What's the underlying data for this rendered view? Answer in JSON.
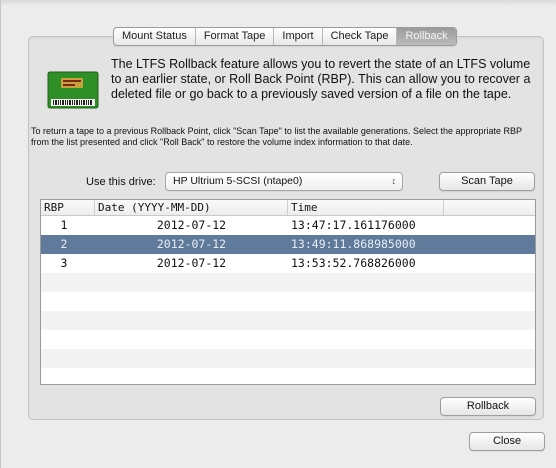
{
  "tabs": [
    {
      "label": "Mount Status"
    },
    {
      "label": "Format Tape"
    },
    {
      "label": "Import"
    },
    {
      "label": "Check Tape"
    },
    {
      "label": "Rollback",
      "active": true
    }
  ],
  "intro_text": "The LTFS Rollback feature allows you to revert the state of an LTFS volume to an earlier state, or Roll Back Point (RBP). This can allow you to recover a deleted file or go back to a previously saved version of a file on the tape.",
  "instructions_text": "To return a tape to a previous Rollback Point, click \"Scan Tape\" to list the available generations. Select the appropriate RBP from the list presented and click \"Roll Back\" to restore the volume index information to that date.",
  "drive": {
    "label": "Use this drive:",
    "selected": "HP Ultrium 5-SCSI (ntape0)"
  },
  "buttons": {
    "scan_tape": "Scan Tape",
    "rollback": "Rollback",
    "close": "Close"
  },
  "table": {
    "columns": [
      "RBP",
      "Date (YYYY-MM-DD)",
      "Time"
    ],
    "rows": [
      {
        "rbp": "1",
        "date": "2012-07-12",
        "time": "13:47:17.161176000"
      },
      {
        "rbp": "2",
        "date": "2012-07-12",
        "time": "13:49:11.868985000"
      },
      {
        "rbp": "3",
        "date": "2012-07-12",
        "time": "13:53:52.768826000"
      }
    ],
    "selected_row": 1
  },
  "colors": {
    "selection": "#5f7a9b",
    "active_tab": "#aaaaaa",
    "tape_green": "#3aa02e"
  }
}
